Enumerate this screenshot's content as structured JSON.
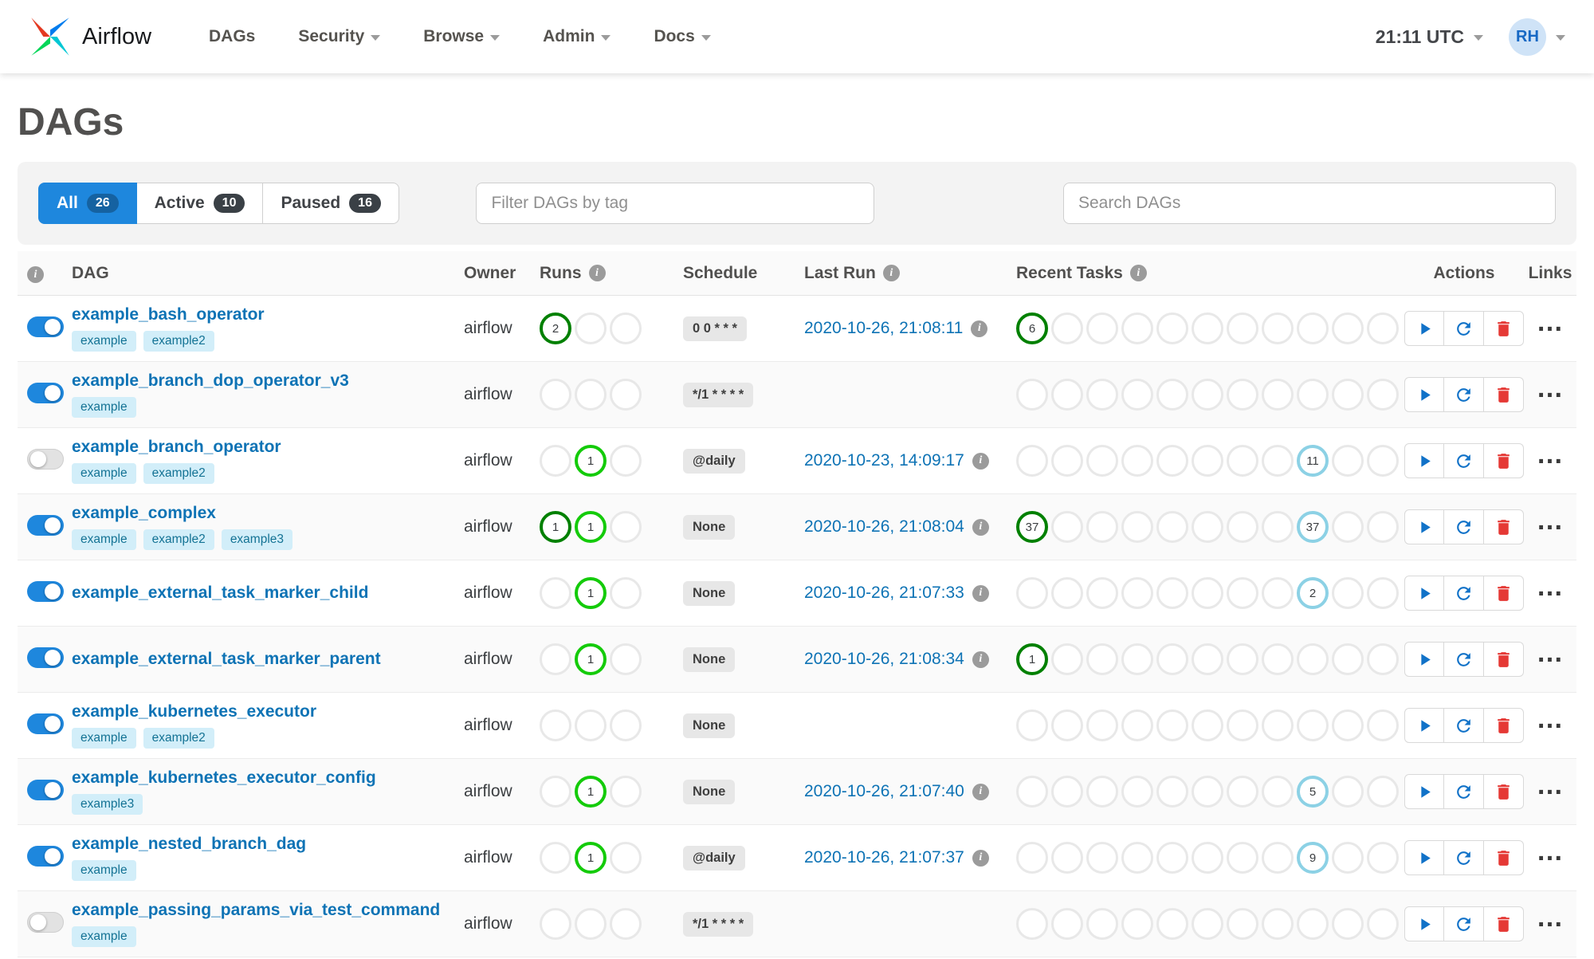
{
  "colors": {
    "accent": "#1e87dd",
    "link": "#0e73b5",
    "success": "#008000",
    "running": "#14cb0a",
    "none": "#8cd1e5",
    "tag-bg": "#d2eef9",
    "tag-text": "#137294",
    "action-blue": "#1172c8",
    "action-red": "#e53935"
  },
  "navbar": {
    "brand": "Airflow",
    "items": [
      {
        "label": "DAGs"
      },
      {
        "label": "Security"
      },
      {
        "label": "Browse"
      },
      {
        "label": "Admin"
      },
      {
        "label": "Docs"
      }
    ],
    "clock": "21:11 UTC",
    "user_initials": "RH"
  },
  "page": {
    "title": "DAGs"
  },
  "filters": {
    "tabs": [
      {
        "label": "All",
        "count": "26",
        "active": true
      },
      {
        "label": "Active",
        "count": "10",
        "active": false
      },
      {
        "label": "Paused",
        "count": "16",
        "active": false
      }
    ],
    "tag_placeholder": "Filter DAGs by tag",
    "search_placeholder": "Search DAGs"
  },
  "table": {
    "headers": {
      "dag": "DAG",
      "owner": "Owner",
      "runs": "Runs",
      "schedule": "Schedule",
      "last_run": "Last Run",
      "recent_tasks": "Recent Tasks",
      "actions": "Actions",
      "links": "Links"
    },
    "links_ellipsis": "…",
    "runs_slots": 3,
    "task_slots": 11,
    "rows": [
      {
        "name": "example_bash_operator",
        "tags": [
          "example",
          "example2"
        ],
        "enabled": true,
        "owner": "airflow",
        "runs": [
          {
            "slot": 0,
            "count": "2",
            "state": "success"
          }
        ],
        "schedule": "0 0 * * *",
        "last_run": "2020-10-26, 21:08:11",
        "tasks": [
          {
            "slot": 0,
            "count": "6",
            "state": "success"
          }
        ]
      },
      {
        "name": "example_branch_dop_operator_v3",
        "tags": [
          "example"
        ],
        "enabled": true,
        "owner": "airflow",
        "runs": [],
        "schedule": "*/1 * * * *",
        "last_run": "",
        "tasks": []
      },
      {
        "name": "example_branch_operator",
        "tags": [
          "example",
          "example2"
        ],
        "enabled": false,
        "owner": "airflow",
        "runs": [
          {
            "slot": 1,
            "count": "1",
            "state": "running"
          }
        ],
        "schedule": "@daily",
        "last_run": "2020-10-23, 14:09:17",
        "tasks": [
          {
            "slot": 8,
            "count": "11",
            "state": "none"
          }
        ]
      },
      {
        "name": "example_complex",
        "tags": [
          "example",
          "example2",
          "example3"
        ],
        "enabled": true,
        "owner": "airflow",
        "runs": [
          {
            "slot": 0,
            "count": "1",
            "state": "success"
          },
          {
            "slot": 1,
            "count": "1",
            "state": "running"
          }
        ],
        "schedule": "None",
        "last_run": "2020-10-26, 21:08:04",
        "tasks": [
          {
            "slot": 0,
            "count": "37",
            "state": "success"
          },
          {
            "slot": 8,
            "count": "37",
            "state": "none"
          }
        ]
      },
      {
        "name": "example_external_task_marker_child",
        "tags": [],
        "enabled": true,
        "owner": "airflow",
        "runs": [
          {
            "slot": 1,
            "count": "1",
            "state": "running"
          }
        ],
        "schedule": "None",
        "last_run": "2020-10-26, 21:07:33",
        "tasks": [
          {
            "slot": 8,
            "count": "2",
            "state": "none"
          }
        ]
      },
      {
        "name": "example_external_task_marker_parent",
        "tags": [],
        "enabled": true,
        "owner": "airflow",
        "runs": [
          {
            "slot": 1,
            "count": "1",
            "state": "running"
          }
        ],
        "schedule": "None",
        "last_run": "2020-10-26, 21:08:34",
        "tasks": [
          {
            "slot": 0,
            "count": "1",
            "state": "success"
          }
        ]
      },
      {
        "name": "example_kubernetes_executor",
        "tags": [
          "example",
          "example2"
        ],
        "enabled": true,
        "owner": "airflow",
        "runs": [],
        "schedule": "None",
        "last_run": "",
        "tasks": []
      },
      {
        "name": "example_kubernetes_executor_config",
        "tags": [
          "example3"
        ],
        "enabled": true,
        "owner": "airflow",
        "runs": [
          {
            "slot": 1,
            "count": "1",
            "state": "running"
          }
        ],
        "schedule": "None",
        "last_run": "2020-10-26, 21:07:40",
        "tasks": [
          {
            "slot": 8,
            "count": "5",
            "state": "none"
          }
        ]
      },
      {
        "name": "example_nested_branch_dag",
        "tags": [
          "example"
        ],
        "enabled": true,
        "owner": "airflow",
        "runs": [
          {
            "slot": 1,
            "count": "1",
            "state": "running"
          }
        ],
        "schedule": "@daily",
        "last_run": "2020-10-26, 21:07:37",
        "tasks": [
          {
            "slot": 8,
            "count": "9",
            "state": "none"
          }
        ]
      },
      {
        "name": "example_passing_params_via_test_command",
        "tags": [
          "example"
        ],
        "enabled": false,
        "owner": "airflow",
        "runs": [],
        "schedule": "*/1 * * * *",
        "last_run": "",
        "tasks": []
      }
    ]
  }
}
